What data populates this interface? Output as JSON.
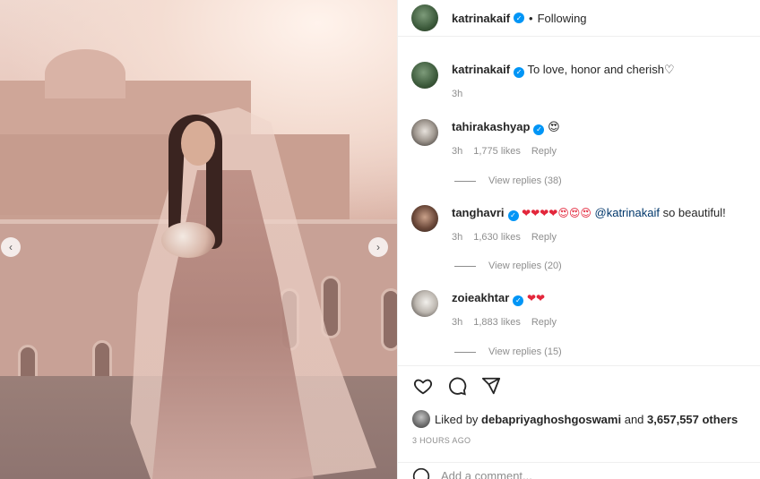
{
  "header": {
    "username": "katrinakaif",
    "separator": "•",
    "follow_state": "Following"
  },
  "caption": {
    "username": "katrinakaif",
    "text": "To love, honor and cherish",
    "emoji": "♡",
    "time": "3h"
  },
  "comments": [
    {
      "username": "tahirakashyap",
      "text": "😍",
      "mention": "",
      "time": "3h",
      "likes": "1,775 likes",
      "reply_label": "Reply",
      "view_replies": "View replies (38)"
    },
    {
      "username": "tanghavri",
      "text": "❤❤❤❤😍😍😍",
      "mention": "@katrinakaif",
      "suffix": "so beautiful!",
      "time": "3h",
      "likes": "1,630 likes",
      "reply_label": "Reply",
      "view_replies": "View replies (20)"
    },
    {
      "username": "zoieakhtar",
      "text": "❤❤",
      "mention": "",
      "time": "3h",
      "likes": "1,883 likes",
      "reply_label": "Reply",
      "view_replies": "View replies (15)"
    }
  ],
  "likes": {
    "prefix": "Liked by",
    "liker": "debapriyaghoshgoswami",
    "connector": "and",
    "others": "3,657,557 others"
  },
  "post_time": "3 HOURS AGO",
  "add_comment": {
    "placeholder": "Add a comment..."
  },
  "colors": {
    "verified": "#0095f6",
    "mention": "#00376b",
    "muted": "#8e8e8e"
  },
  "icons": [
    "heart-icon",
    "comment-icon",
    "share-icon",
    "emoji-icon",
    "chevron-left-icon",
    "chevron-right-icon",
    "verified-icon"
  ]
}
